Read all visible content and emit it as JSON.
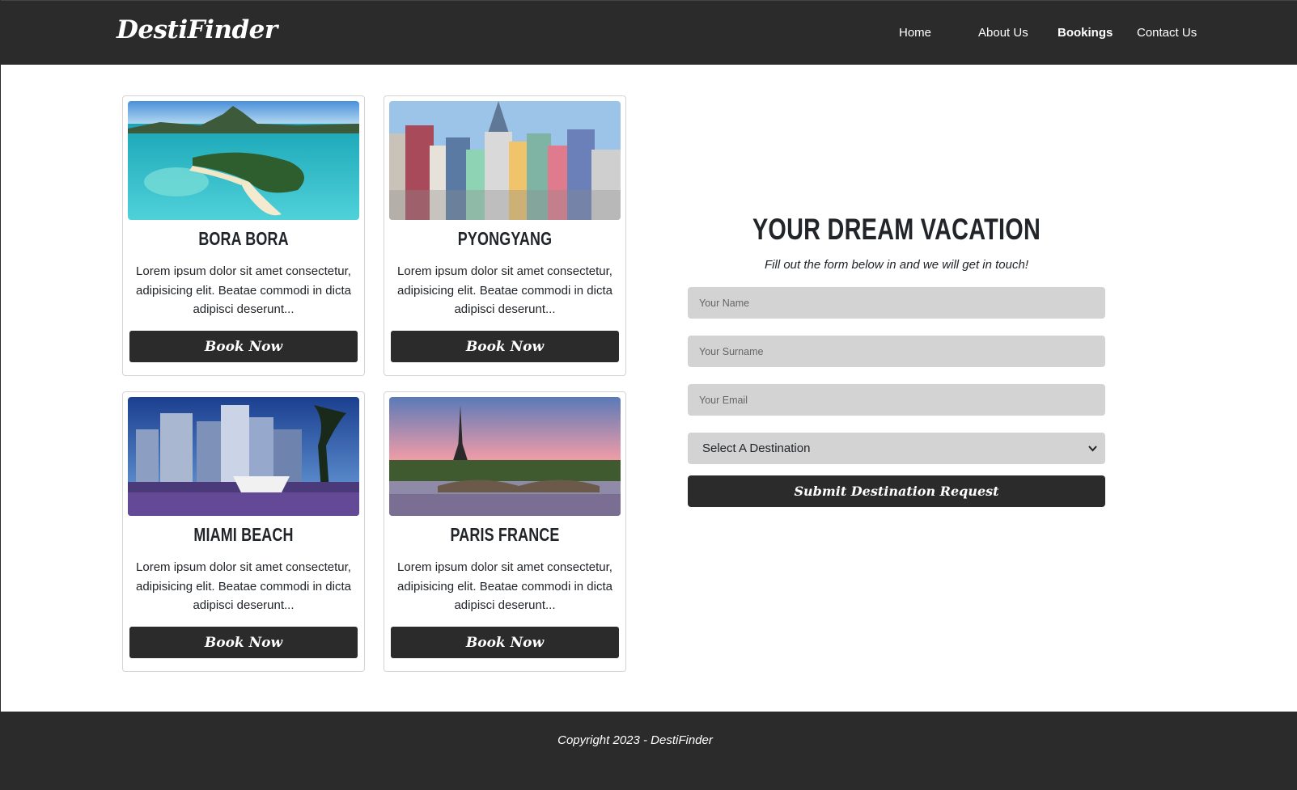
{
  "brand": {
    "name": "DestiFinder"
  },
  "nav": {
    "items": [
      {
        "label": "Home"
      },
      {
        "label": "About Us"
      },
      {
        "label": "Bookings"
      },
      {
        "label": "Contact Us"
      }
    ],
    "active": "Bookings"
  },
  "cards": [
    {
      "title": "BORA BORA",
      "text": "Lorem ipsum dolor sit amet consectetur, adipisicing elit. Beatae commodi in dicta adipisci deserunt...",
      "button": "Book Now",
      "image": "tropical-island-lagoon"
    },
    {
      "title": "PYONGYANG",
      "text": "Lorem ipsum dolor sit amet consectetur, adipisicing elit. Beatae commodi in dicta adipisci deserunt...",
      "button": "Book Now",
      "image": "city-skyline"
    },
    {
      "title": "MIAMI BEACH",
      "text": "Lorem ipsum dolor sit amet consectetur, adipisicing elit. Beatae commodi in dicta adipisci deserunt...",
      "button": "Book Now",
      "image": "night-waterfront-skyline"
    },
    {
      "title": "PARIS FRANCE",
      "text": "Lorem ipsum dolor sit amet consectetur, adipisicing elit. Beatae commodi in dicta adipisci deserunt...",
      "button": "Book Now",
      "image": "eiffel-tower-sunset"
    }
  ],
  "form": {
    "title": "YOUR DREAM VACATION",
    "subtitle": "Fill out the form below in and we will get in touch!",
    "name_placeholder": "Your Name",
    "surname_placeholder": "Your Surname",
    "email_placeholder": "Your Email",
    "destination_selected": "Select A Destination",
    "submit_label": "Submit Destination Request"
  },
  "footer": {
    "text": "Copyright 2023 - DestiFinder"
  },
  "colors": {
    "dark": "#2b2b2b",
    "input_bg": "#d3d3d3",
    "text": "#212529"
  }
}
